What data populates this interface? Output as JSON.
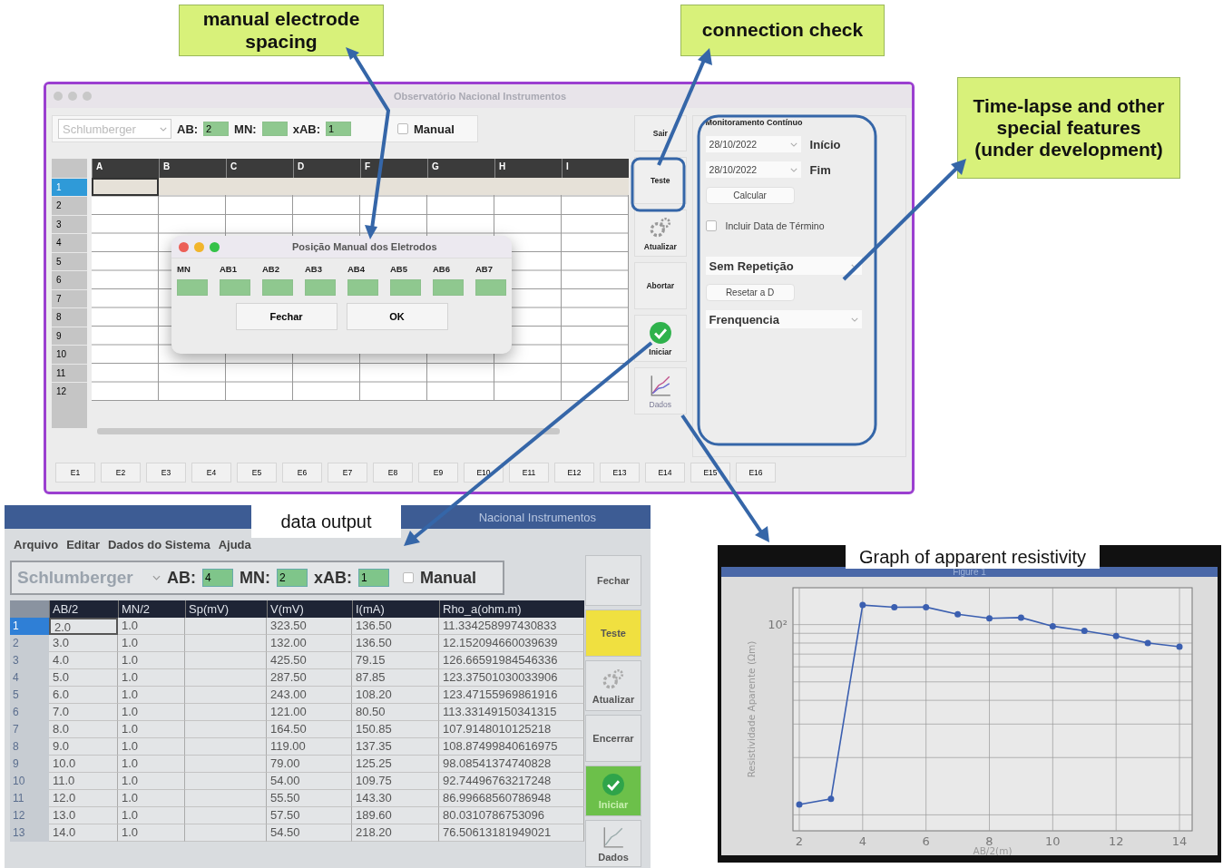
{
  "callouts": [
    {
      "kind": "note",
      "text": "manual electrode spacing"
    },
    {
      "kind": "note",
      "text": "connection check"
    },
    {
      "kind": "note",
      "text": "Time-lapse and other special features (under development)"
    },
    {
      "kind": "tag",
      "text": "data output"
    },
    {
      "kind": "tag",
      "text": "Graph of apparent resistivity"
    }
  ],
  "main_window": {
    "title": "Observatório Nacional Instrumentos",
    "toolbar": {
      "array_type": "Schlumberger",
      "fields": [
        {
          "label": "AB:",
          "value": "2"
        },
        {
          "label": "MN:"
        },
        {
          "label": "xAB:",
          "value": "1"
        }
      ],
      "manual": {
        "label": "Manual",
        "checked": false
      }
    },
    "grid": {
      "columns": [
        "A",
        "B",
        "C",
        "D",
        "F",
        "G",
        "H",
        "I"
      ],
      "rows": [
        {
          "label": "1",
          "selected": true
        },
        {
          "label": "2",
          "selected": false
        },
        {
          "label": "3",
          "selected": false
        },
        {
          "label": "4",
          "selected": false
        },
        {
          "label": "5",
          "selected": false
        },
        {
          "label": "6",
          "selected": false
        },
        {
          "label": "7",
          "selected": false
        },
        {
          "label": "8",
          "selected": false
        },
        {
          "label": "9",
          "selected": false
        },
        {
          "label": "10",
          "selected": false
        },
        {
          "label": "11",
          "selected": false
        },
        {
          "label": "12",
          "selected": false
        }
      ]
    },
    "dialog": {
      "title": "Posição Manual dos Eletrodos",
      "fields": [
        "MN",
        "AB1",
        "AB2",
        "AB3",
        "AB4",
        "AB5",
        "AB6",
        "AB7"
      ],
      "buttons": [
        "Fechar",
        "OK"
      ]
    },
    "side_buttons": [
      {
        "label": "Sair",
        "kind": "text",
        "disabled": false
      },
      {
        "label": "Teste",
        "kind": "text",
        "disabled": false
      },
      {
        "label": "Atualizar",
        "kind": "gear",
        "disabled": false
      },
      {
        "label": "Abortar",
        "kind": "text",
        "disabled": false
      },
      {
        "label": "Iniciar",
        "kind": "check",
        "disabled": false
      },
      {
        "label": "Dados",
        "kind": "chart",
        "disabled": true
      }
    ],
    "electrodes": [
      "E1",
      "E2",
      "E3",
      "E4",
      "E5",
      "E6",
      "E7",
      "E8",
      "E9",
      "E10",
      "E11",
      "E12",
      "E13",
      "E14",
      "E15",
      "E16"
    ],
    "monitor": {
      "title": "Monitoramento Contínuo",
      "start": {
        "value": "28/10/2022",
        "label": "Início"
      },
      "end": {
        "value": "28/10/2022",
        "label": "Fim"
      },
      "calculate": "Calcular",
      "include_end": {
        "label": "Incluir Data de Término",
        "checked": false
      },
      "repeat": "Sem Repetição",
      "reset": "Resetar a D",
      "frequency": "Frenquencia"
    }
  },
  "data_window": {
    "title": "Nacional Instrumentos",
    "menu": [
      "Arquivo",
      "Editar",
      "Dados do Sistema",
      "Ajuda"
    ],
    "toolbar": {
      "array_type": "Schlumberger",
      "fields": [
        {
          "label": "AB:",
          "value": "4"
        },
        {
          "label": "MN:",
          "value": "2"
        },
        {
          "label": "xAB:",
          "value": "1"
        }
      ],
      "manual": {
        "label": "Manual",
        "checked": false
      }
    },
    "table": {
      "columns": [
        "AB/2",
        "MN/2",
        "Sp(mV)",
        "V(mV)",
        "I(mA)",
        "Rho_a(ohm.m)"
      ],
      "rows": [
        {
          "label": "1",
          "selected": true,
          "cells": [
            "2.0",
            "1.0",
            "",
            "323.50",
            "136.50",
            "11.334258997430833"
          ]
        },
        {
          "label": "2",
          "selected": false,
          "cells": [
            "3.0",
            "1.0",
            "",
            "132.00",
            "136.50",
            "12.152094660039639"
          ]
        },
        {
          "label": "3",
          "selected": false,
          "cells": [
            "4.0",
            "1.0",
            "",
            "425.50",
            "79.15",
            "126.66591984546336"
          ]
        },
        {
          "label": "4",
          "selected": false,
          "cells": [
            "5.0",
            "1.0",
            "",
            "287.50",
            "87.85",
            "123.37501030033906"
          ]
        },
        {
          "label": "5",
          "selected": false,
          "cells": [
            "6.0",
            "1.0",
            "",
            "243.00",
            "108.20",
            "123.47155969861916"
          ]
        },
        {
          "label": "6",
          "selected": false,
          "cells": [
            "7.0",
            "1.0",
            "",
            "121.00",
            "80.50",
            "113.33149150341315"
          ]
        },
        {
          "label": "7",
          "selected": false,
          "cells": [
            "8.0",
            "1.0",
            "",
            "164.50",
            "150.85",
            "107.9148010125218"
          ]
        },
        {
          "label": "8",
          "selected": false,
          "cells": [
            "9.0",
            "1.0",
            "",
            "119.00",
            "137.35",
            "108.87499840616975"
          ]
        },
        {
          "label": "9",
          "selected": false,
          "cells": [
            "10.0",
            "1.0",
            "",
            "79.00",
            "125.25",
            "98.08541374740828"
          ]
        },
        {
          "label": "10",
          "selected": false,
          "cells": [
            "11.0",
            "1.0",
            "",
            "54.00",
            "109.75",
            "92.74496763217248"
          ]
        },
        {
          "label": "11",
          "selected": false,
          "cells": [
            "12.0",
            "1.0",
            "",
            "55.50",
            "143.30",
            "86.99668560786948"
          ]
        },
        {
          "label": "12",
          "selected": false,
          "cells": [
            "13.0",
            "1.0",
            "",
            "57.50",
            "189.60",
            "80.0310786753096"
          ]
        },
        {
          "label": "13",
          "selected": false,
          "cells": [
            "14.0",
            "1.0",
            "",
            "54.50",
            "218.20",
            "76.50613181949021"
          ]
        }
      ]
    },
    "side_buttons": [
      {
        "label": "Fechar",
        "kind": "text"
      },
      {
        "label": "Teste",
        "kind": "text",
        "color": "#f0e040"
      },
      {
        "label": "Atualizar",
        "kind": "gear"
      },
      {
        "label": "Encerrar",
        "kind": "text"
      },
      {
        "label": "Iniciar",
        "kind": "check",
        "color": "#6cc04a"
      },
      {
        "label": "Dados",
        "kind": "chart"
      }
    ]
  },
  "graph_window": {
    "title": "Figure 1",
    "y_axis_label": "Resistividade Aparente (Ωm)",
    "y_tick_label": "10²",
    "x_tick_labels": [
      "2",
      "4",
      "6",
      "8",
      "10",
      "12",
      "14"
    ],
    "x_axis_label": "AB/2(m)"
  }
}
